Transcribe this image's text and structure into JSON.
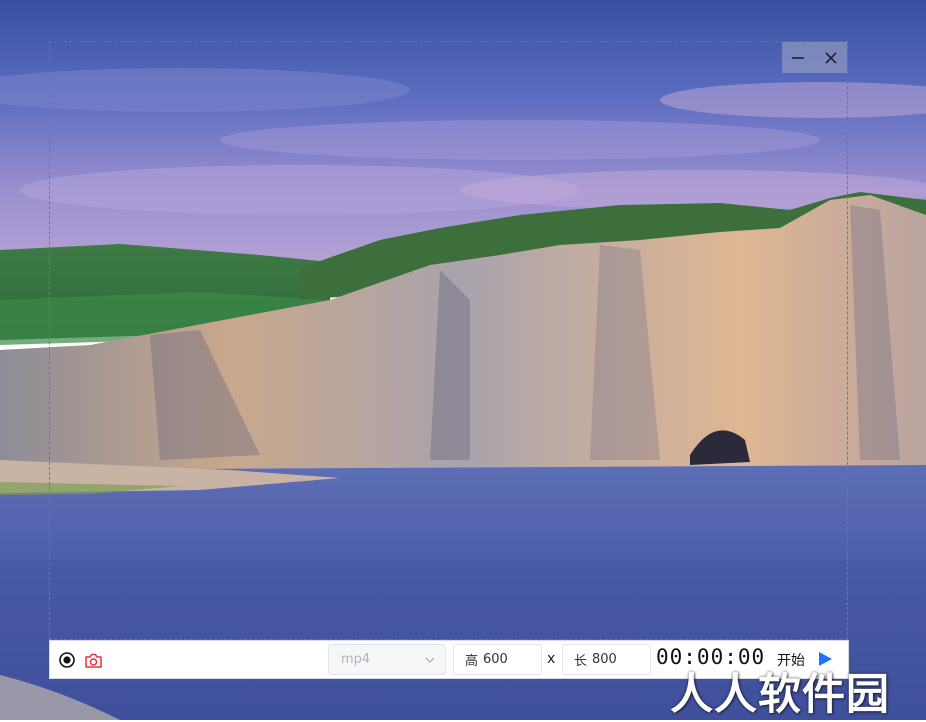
{
  "recorder": {
    "format_select": {
      "value": "mp4"
    },
    "height_field": {
      "label": "高",
      "value": "600"
    },
    "times_sign": "x",
    "width_field": {
      "label": "长",
      "value": "800"
    },
    "timer": "00:00:00",
    "start_label": "开始"
  },
  "icons": {
    "record_mode": "record-circle-icon",
    "screenshot": "camera-icon",
    "minimize": "minimize-icon",
    "close": "close-icon",
    "dropdown": "chevron-down-icon",
    "start": "play-icon"
  },
  "colors": {
    "frame_border": "#3a7bff",
    "camera": "#e5343a",
    "play": "#1e74ff"
  },
  "watermark": "人人软件园"
}
